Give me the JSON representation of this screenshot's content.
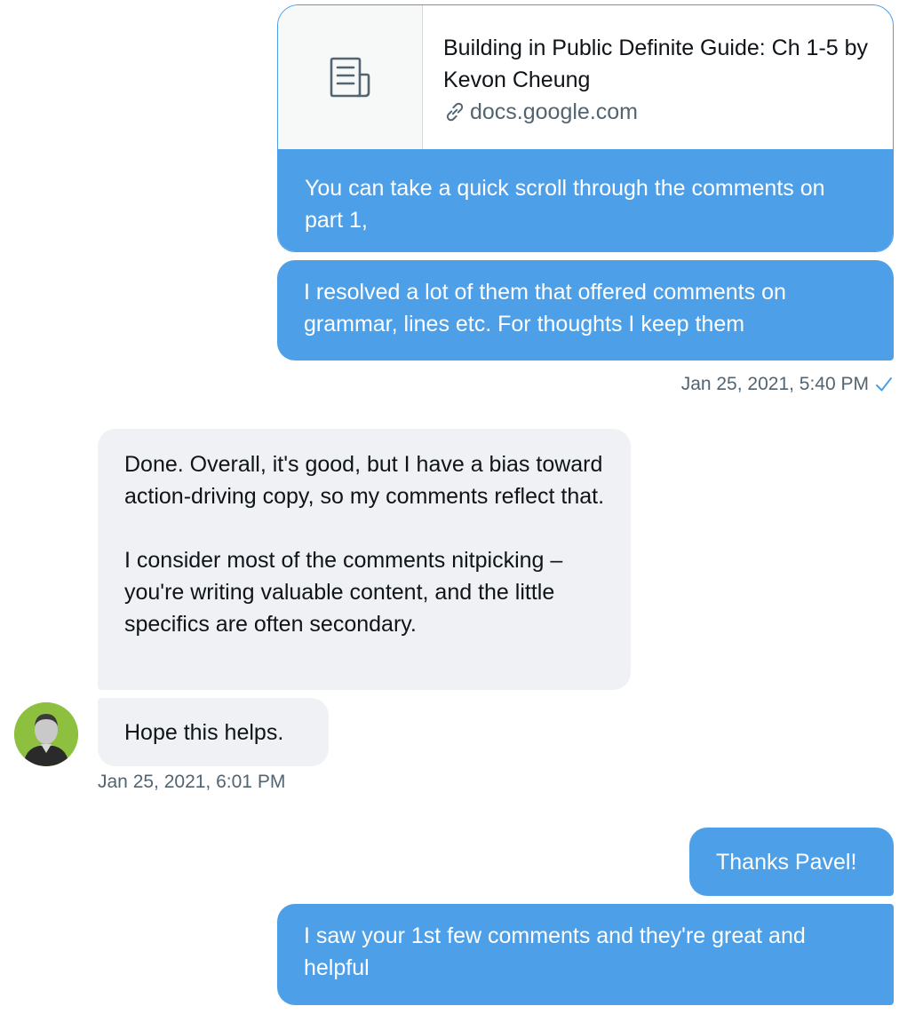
{
  "link_card": {
    "title": "Building in Public Definite Guide: Ch 1-5 by Kevon Cheung",
    "domain": "docs.google.com",
    "message": "You can take a quick scroll through the comments on part 1,"
  },
  "messages": {
    "out_1": "I resolved a lot of them that offered comments on grammar, lines etc. For thoughts I keep them",
    "timestamp_1": "Jan 25, 2021, 5:40 PM",
    "in_1_para1": "Done. Overall, it's good, but I have a bias toward action-driving copy, so my comments reflect that.",
    "in_1_para2": "I consider most of the comments nitpicking – you're writing valuable content, and the little specifics are often secondary.",
    "in_2": "Hope this helps.",
    "timestamp_2": "Jan 25, 2021, 6:01 PM",
    "out_2": "Thanks Pavel!",
    "out_3": "I saw your 1st few comments and they're great and helpful"
  },
  "colors": {
    "outgoing_bubble": "#4d9fe8",
    "incoming_bubble": "#eff1f4",
    "avatar_background": "#8cc03e",
    "read_check": "#4d9fe8"
  },
  "icons": {
    "card_thumbnail": "document-icon",
    "link": "link-icon",
    "read_receipt": "check-icon"
  }
}
